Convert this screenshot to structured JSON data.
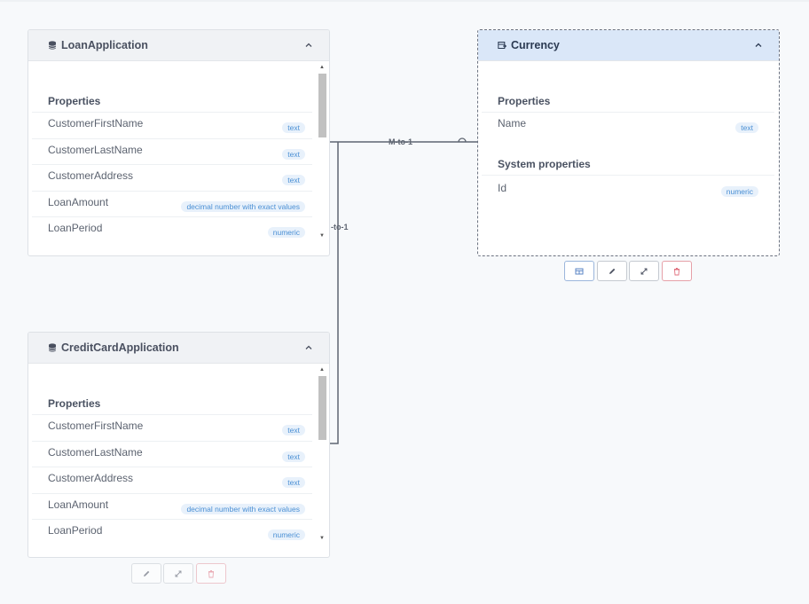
{
  "entities": {
    "loan": {
      "title": "LoanApplication",
      "icon": "database-icon",
      "properties_heading": "Properties",
      "properties": [
        {
          "name": "CustomerFirstName",
          "type": "text"
        },
        {
          "name": "CustomerLastName",
          "type": "text"
        },
        {
          "name": "CustomerAddress",
          "type": "text"
        },
        {
          "name": "LoanAmount",
          "type": "decimal number with exact values"
        },
        {
          "name": "LoanPeriod",
          "type": "numeric"
        }
      ]
    },
    "credit": {
      "title": "CreditCardApplication",
      "icon": "database-icon",
      "properties_heading": "Properties",
      "properties": [
        {
          "name": "CustomerFirstName",
          "type": "text"
        },
        {
          "name": "CustomerLastName",
          "type": "text"
        },
        {
          "name": "CustomerAddress",
          "type": "text"
        },
        {
          "name": "LoanAmount",
          "type": "decimal number with exact values"
        },
        {
          "name": "LoanPeriod",
          "type": "numeric"
        }
      ]
    },
    "currency": {
      "title": "Currency",
      "icon": "lookup-table-icon",
      "properties_heading": "Properties",
      "properties": [
        {
          "name": "Name",
          "type": "text"
        }
      ],
      "system_heading": "System properties",
      "system_properties": [
        {
          "name": "Id",
          "type": "numeric"
        }
      ]
    }
  },
  "relations": {
    "loan_currency": "M-to-1",
    "credit_currency": "-to-1"
  },
  "toolbars": {
    "currency": [
      "table-icon",
      "pencil-icon",
      "expand-icon",
      "trash-icon"
    ],
    "credit": [
      "pencil-icon",
      "expand-icon",
      "trash-icon"
    ]
  },
  "colors": {
    "selected_header": "#dae7f8",
    "badge_text": "#4a8fd4",
    "badge_bg": "#e8f1fb",
    "danger": "#e0707e",
    "primary": "#5b86c6"
  }
}
